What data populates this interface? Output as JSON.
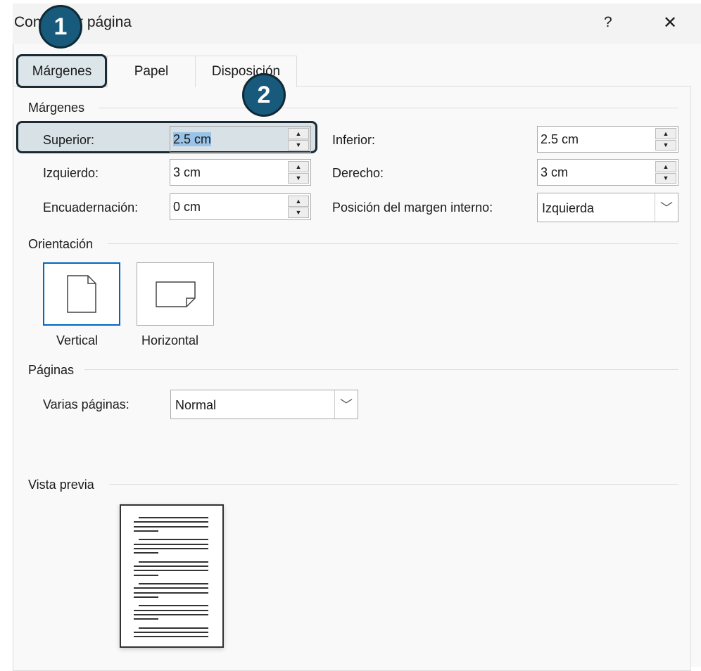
{
  "dialog": {
    "title": "Configurar página",
    "help": "?",
    "close": "✕"
  },
  "tabs": [
    "Márgenes",
    "Papel",
    "Disposición"
  ],
  "margins": {
    "section": "Márgenes",
    "superior": {
      "label": "Superior:",
      "value": "2.5 cm"
    },
    "inferior": {
      "label": "Inferior:",
      "value": "2.5 cm"
    },
    "izquierdo": {
      "label": "Izquierdo:",
      "value": "3 cm"
    },
    "derecho": {
      "label": "Derecho:",
      "value": "3 cm"
    },
    "encuadernacion": {
      "label": "Encuadernación:",
      "value": "0 cm"
    },
    "posicion": {
      "label": "Posición del margen interno:",
      "value": "Izquierda"
    }
  },
  "orientation": {
    "section": "Orientación",
    "vertical": "Vertical",
    "horizontal": "Horizontal",
    "selected": "Vertical"
  },
  "pages": {
    "section": "Páginas",
    "label": "Varias páginas:",
    "value": "Normal"
  },
  "preview": {
    "section": "Vista previa"
  },
  "badges": [
    "1",
    "2"
  ],
  "colors": {
    "badge": "#175a7c",
    "selection": "#99c3e8"
  }
}
